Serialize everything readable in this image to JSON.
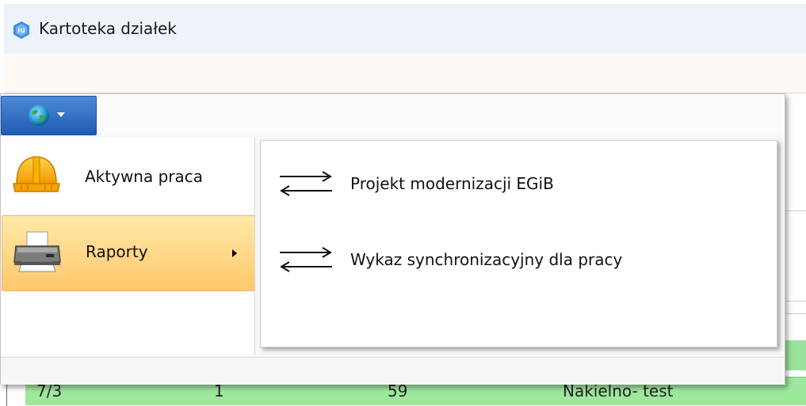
{
  "window": {
    "title": "Kartoteka działek",
    "app_icon": "app-logo-icon"
  },
  "menu": {
    "app_button_icon": "globe-icon",
    "items": [
      {
        "label": "Aktywna praca",
        "icon": "hard-hat-icon"
      },
      {
        "label": "Raporty",
        "icon": "printer-icon",
        "has_submenu": true,
        "active": true
      }
    ],
    "submenu": {
      "items": [
        {
          "label": "Projekt modernizacji EGiB",
          "icon": "swap-arrows-icon"
        },
        {
          "label": "Wykaz synchronizacyjny dla pracy",
          "icon": "swap-arrows-icon"
        }
      ]
    }
  },
  "grid": {
    "row": [
      "7/3",
      "1",
      "59",
      "Nakielno- test"
    ],
    "colors": {
      "row_bg": "#9ee89e"
    }
  },
  "colors": {
    "accent": "#1f5bb3",
    "highlight": "#ffc76b"
  }
}
